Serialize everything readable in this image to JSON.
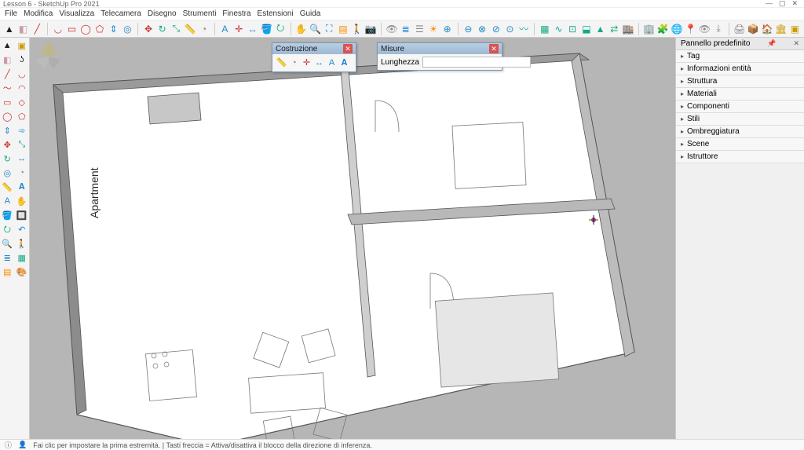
{
  "window": {
    "title": "Lesson 6 - SketchUp Pro 2021"
  },
  "menu": {
    "items": [
      "File",
      "Modifica",
      "Visualizza",
      "Telecamera",
      "Disegno",
      "Strumenti",
      "Finestra",
      "Estensioni",
      "Guida"
    ]
  },
  "main_toolbar": {
    "icons": [
      "select",
      "eraser",
      "line",
      "arc",
      "rectangle",
      "circle",
      "polygon",
      "pushpull",
      "offset",
      "move",
      "rotate",
      "scale",
      "tape",
      "protractor",
      "text",
      "axes",
      "dimension",
      "paint",
      "orbit",
      "pan",
      "zoom",
      "zoom-extents",
      "section",
      "walk",
      "position-camera",
      "look",
      "layers",
      "outliner",
      "shadows",
      "solid-union",
      "solid-subtract",
      "solid-intersect",
      "solid-trim",
      "solid-split",
      "sandbox-contours",
      "sandbox-scratch",
      "sandbox-smoove",
      "sandbox-stamp",
      "sandbox-drape",
      "sandbox-detail",
      "sandbox-flip",
      "warehouse",
      "3dwarehouse",
      "extension",
      "geo",
      "add-location",
      "preview",
      "export",
      "print",
      "componentize",
      "house",
      "building",
      "groups"
    ]
  },
  "left_toolbar": {
    "col1": [
      "select",
      "eraser",
      "line",
      "freehand",
      "rectangle",
      "circle",
      "pushpull",
      "move",
      "rotate",
      "offset",
      "tape",
      "text",
      "paint",
      "orbit",
      "zoom",
      "layers",
      "section"
    ],
    "col2": [
      "make-component",
      "lasso",
      "arc",
      "2pt-arc",
      "rot-rectangle",
      "polygon",
      "followme",
      "scale",
      "dimension",
      "protractor",
      "3d-text",
      "pan",
      "zoom-window",
      "prev-view",
      "walk",
      "sandbox",
      "style"
    ]
  },
  "viewport": {
    "model_label": "Apartment"
  },
  "float_panels": {
    "construction": {
      "title": "Costruzione",
      "icons": [
        "tape",
        "protractor",
        "axes",
        "dimension",
        "text",
        "3d-text"
      ]
    },
    "measure": {
      "title": "Misure",
      "label": "Lunghezza",
      "value": ""
    }
  },
  "right_panel": {
    "header": "Pannello predefinito",
    "items": [
      "Tag",
      "Informazioni entità",
      "Struttura",
      "Materiali",
      "Componenti",
      "Stili",
      "Ombreggiatura",
      "Scene",
      "Istruttore"
    ]
  },
  "statusbar": {
    "hint": "Fai clic per impostare la prima estremità. | Tasti freccia = Attiva/disattiva il blocco della direzione di inferenza."
  },
  "icon_glyphs": {
    "select": "▲",
    "eraser": "◧",
    "line": "╱",
    "arc": "◡",
    "rectangle": "▭",
    "circle": "◯",
    "polygon": "⬠",
    "pushpull": "⇕",
    "offset": "◎",
    "move": "✥",
    "rotate": "↻",
    "scale": "⤡",
    "tape": "📏",
    "protractor": "◔",
    "text": "A",
    "axes": "✛",
    "dimension": "↔",
    "paint": "🪣",
    "orbit": "⭮",
    "pan": "✋",
    "zoom": "🔍",
    "zoom-extents": "⛶",
    "section": "▤",
    "walk": "🚶",
    "position-camera": "📷",
    "look": "👁",
    "layers": "≣",
    "outliner": "☰",
    "shadows": "☀",
    "solid-union": "⊕",
    "solid-subtract": "⊖",
    "solid-intersect": "⊗",
    "solid-trim": "⊘",
    "solid-split": "⊙",
    "sandbox-contours": "〰",
    "sandbox-scratch": "▦",
    "sandbox-smoove": "∿",
    "sandbox-stamp": "⊡",
    "sandbox-drape": "⬓",
    "sandbox-detail": "▲",
    "sandbox-flip": "⇄",
    "warehouse": "🏬",
    "3dwarehouse": "🏢",
    "extension": "🧩",
    "geo": "🌐",
    "add-location": "📍",
    "preview": "👁",
    "export": "⤓",
    "print": "🖨",
    "componentize": "📦",
    "house": "🏠",
    "building": "🏛",
    "groups": "▣",
    "make-component": "▣",
    "lasso": "ʖ",
    "freehand": "～",
    "2pt-arc": "◠",
    "rot-rectangle": "◇",
    "followme": "➾",
    "3d-text": "𝐀",
    "zoom-window": "🔲",
    "prev-view": "↶",
    "sandbox": "▦",
    "style": "🎨"
  },
  "colors": {
    "select": "#222",
    "eraser": "#c9a",
    "line": "#c33",
    "arc": "#c33",
    "rectangle": "#c33",
    "circle": "#c33",
    "polygon": "#c33",
    "pushpull": "#28c",
    "offset": "#28c",
    "move": "#c33",
    "rotate": "#1a8",
    "scale": "#1a8",
    "tape": "#888",
    "protractor": "#888",
    "text": "#28c",
    "axes": "#c33",
    "dimension": "#28c",
    "paint": "#c80",
    "orbit": "#1a8",
    "pan": "#c90",
    "zoom": "#28c",
    "zoom-extents": "#28c",
    "section": "#f80",
    "walk": "#888",
    "position-camera": "#888",
    "look": "#888",
    "layers": "#28c",
    "outliner": "#888",
    "shadows": "#f80",
    "solid-union": "#28c",
    "solid-subtract": "#28c",
    "solid-intersect": "#28c",
    "solid-trim": "#28c",
    "solid-split": "#28c",
    "sandbox-contours": "#1a8",
    "sandbox-scratch": "#1a8",
    "sandbox-smoove": "#1a8",
    "sandbox-stamp": "#1a8",
    "sandbox-drape": "#1a8",
    "sandbox-detail": "#1a8",
    "sandbox-flip": "#1a8",
    "warehouse": "#c90",
    "3dwarehouse": "#c90",
    "extension": "#888",
    "geo": "#28c",
    "add-location": "#c33",
    "preview": "#888",
    "export": "#888",
    "print": "#888",
    "componentize": "#c90",
    "house": "#c90",
    "building": "#c90",
    "groups": "#c90",
    "make-component": "#c90",
    "lasso": "#222",
    "freehand": "#c33",
    "2pt-arc": "#c33",
    "rot-rectangle": "#c33",
    "followme": "#28c",
    "3d-text": "#28c",
    "zoom-window": "#28c",
    "prev-view": "#28c",
    "sandbox": "#1a8",
    "style": "#c80"
  }
}
